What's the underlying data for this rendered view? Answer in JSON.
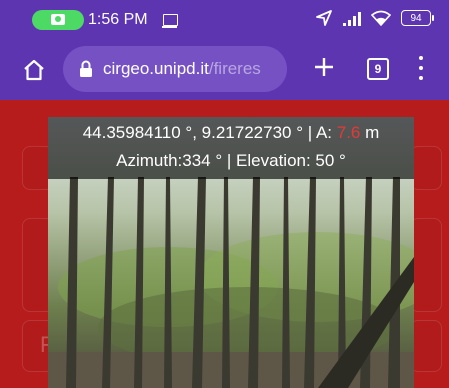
{
  "status_bar": {
    "time": "1:56 PM",
    "battery": "94",
    "icons": [
      "camera-icon",
      "message-icon",
      "navigation-arrow-icon",
      "signal-icon",
      "wifi-icon",
      "battery-icon"
    ]
  },
  "browser": {
    "url_host": "cirgeo.unipd.it",
    "url_path": "/fireres",
    "tab_count": "9",
    "icons": [
      "home-icon",
      "lock-icon",
      "plus-icon",
      "tabs-icon",
      "menu-icon"
    ]
  },
  "photo_overlay": {
    "coords": "44.35984110 °, 9.21722730 °",
    "sep1": " | ",
    "accuracy_label": "A:",
    "accuracy_value": "7.6",
    "accuracy_unit": "m",
    "azimuth": "Azimuth:334 °",
    "sep2": " | ",
    "elevation": "Elevation: 50 °"
  },
  "background_page": {
    "visible_letter_left": "F"
  },
  "colors": {
    "toolbar": "#5e35b1",
    "page_bg": "#b71c1c",
    "accuracy": "#e53935",
    "camera_pill": "#4cd964"
  }
}
